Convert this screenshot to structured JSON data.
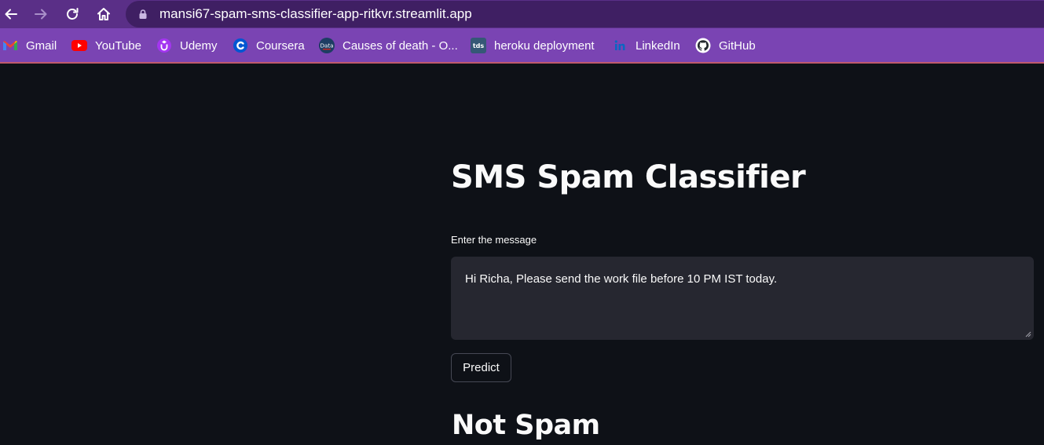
{
  "browser": {
    "url": "mansi67-spam-sms-classifier-app-ritkvr.streamlit.app",
    "bookmarks": [
      {
        "label": "Gmail",
        "icon": "gmail-icon"
      },
      {
        "label": "YouTube",
        "icon": "youtube-icon"
      },
      {
        "label": "Udemy",
        "icon": "udemy-icon"
      },
      {
        "label": "Coursera",
        "icon": "coursera-icon"
      },
      {
        "label": "Causes of death - O...",
        "icon": "ourworldindata-icon",
        "icon_text": "Data"
      },
      {
        "label": "heroku deployment",
        "icon": "tds-icon",
        "icon_text": "tds"
      },
      {
        "label": "LinkedIn",
        "icon": "linkedin-icon"
      },
      {
        "label": "GitHub",
        "icon": "github-icon"
      }
    ]
  },
  "app": {
    "title": "SMS Spam Classifier",
    "input_label": "Enter the message",
    "message": "Hi Richa, Please send the work file before 10 PM IST today.",
    "predict_label": "Predict",
    "result": "Not Spam"
  },
  "colors": {
    "toolbar_bg": "#5a2f87",
    "omnibox_bg": "#3f1f63",
    "bookmarks_bg": "#7a44b3",
    "page_bg": "#0e1117",
    "textarea_bg": "#262730",
    "text": "#fafafa"
  }
}
